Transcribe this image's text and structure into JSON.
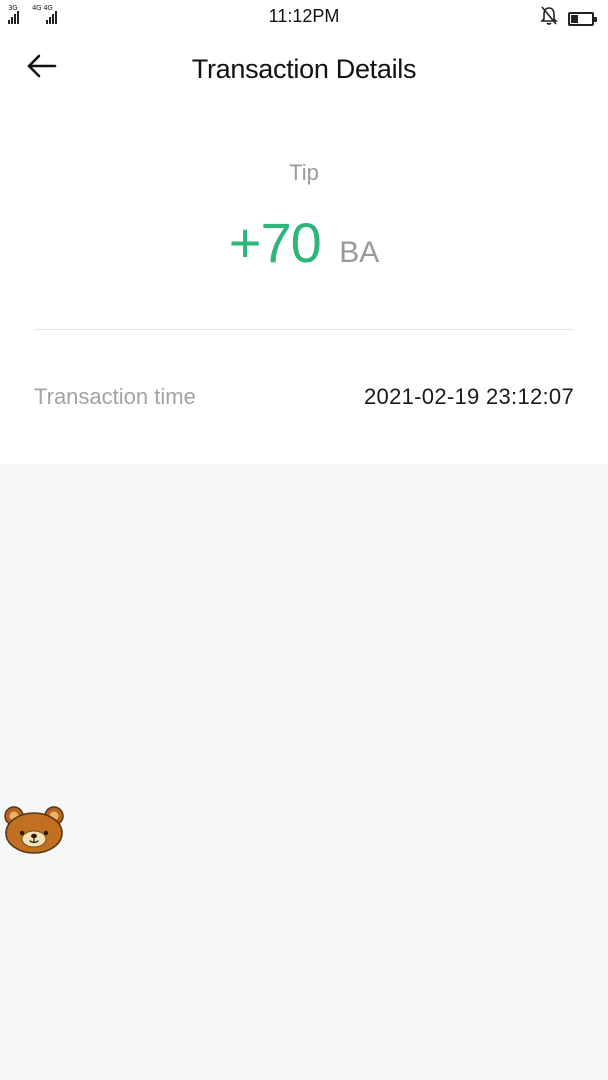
{
  "status_bar": {
    "sim1_label": "3G",
    "sim2_label": "4G 4G",
    "time": "11:12PM",
    "mute_icon": "bell-off-icon",
    "battery_icon": "battery-icon",
    "battery_level": 0.3
  },
  "header": {
    "back_icon": "arrow-left-icon",
    "title": "Transaction Details"
  },
  "transaction": {
    "type": "Tip",
    "amount": "+70",
    "unit": "BA",
    "amount_color": "#2db57a",
    "details": [
      {
        "label": "Transaction time",
        "value": "2021-02-19 23:12:07"
      }
    ]
  },
  "floating_widget": {
    "icon": "bear-face-icon"
  },
  "colors": {
    "background": "#f6f7f9",
    "card": "#ffffff",
    "accent_green": "#2db57a",
    "muted_text": "#9a9a9a"
  }
}
